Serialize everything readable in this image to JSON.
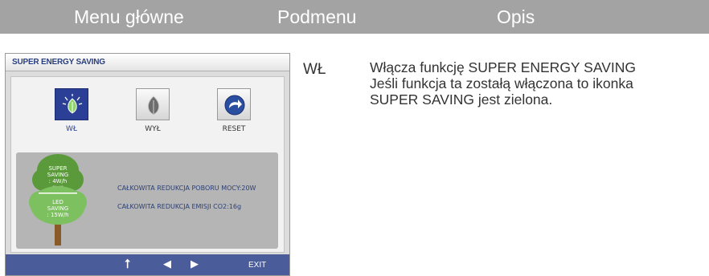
{
  "header": {
    "main_menu": "Menu główne",
    "submenu": "Podmenu",
    "description": "Opis"
  },
  "osd": {
    "title": "SUPER ENERGY SAVING",
    "options": [
      {
        "label": "WŁ",
        "icon": "leaf-sparkle-icon",
        "selected": true
      },
      {
        "label": "WYŁ",
        "icon": "leaf-icon",
        "selected": false
      },
      {
        "label": "RESET",
        "icon": "reset-arrow-icon",
        "selected": false
      }
    ],
    "tree": {
      "super_saving_line1": "SUPER",
      "super_saving_line2": "SAVING",
      "super_saving_value": ": 4W/h",
      "led_saving_line1": "LED",
      "led_saving_line2": "SAVING",
      "led_saving_value": ": 15W/h"
    },
    "info": {
      "power_reduction": "CAŁKOWITA REDUKCJA POBORU MOCY:20W",
      "co2_reduction": "CAŁKOWITA REDUKCJA EMISJI CO2:16g"
    },
    "nav": {
      "up": "up-arrow-icon",
      "left": "left-arrow-icon",
      "right": "right-arrow-icon",
      "exit": "EXIT"
    },
    "colors": {
      "selected": "#2a3f95",
      "nav_bar": "#4a5c9a",
      "tree_dark": "#5a9a3a",
      "tree_light": "#7cc060"
    }
  },
  "submenu_item": "WŁ",
  "description": {
    "line1": "Włącza  funkcję SUPER ENERGY SAVING",
    "line2": "Jeśli funkcja ta zostałą włączona to ikonka",
    "line3": "SUPER SAVING jest zielona."
  }
}
